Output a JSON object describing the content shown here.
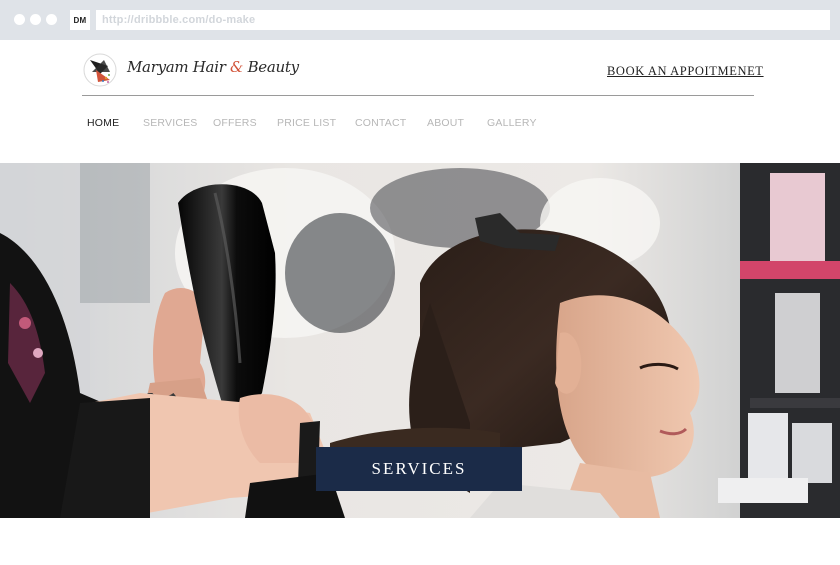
{
  "browser": {
    "favicon_text": "DM",
    "url": "http://dribbble.com/do-make"
  },
  "header": {
    "logo_text_part1": "Maryam Hair ",
    "logo_amp": "&",
    "logo_text_part2": " Beauty",
    "book_link": "BOOK AN APPOITMENET"
  },
  "nav": {
    "items": [
      {
        "label": "HOME",
        "active": true
      },
      {
        "label": "SERVICES",
        "active": false
      },
      {
        "label": "OFFERS",
        "active": false
      },
      {
        "label": "PRICE LIST",
        "active": false
      },
      {
        "label": "CONTACT",
        "active": false
      },
      {
        "label": "ABOUT",
        "active": false
      },
      {
        "label": "GALLERY",
        "active": false
      }
    ]
  },
  "hero": {
    "image_icon": "hair-salon-photo",
    "cta_label": "SERVICES"
  },
  "colors": {
    "accent": "#d2543a",
    "cta_bg": "#1b2b48",
    "nav_inactive": "#b7b7b7",
    "chrome_bg": "#dfe3e8"
  }
}
